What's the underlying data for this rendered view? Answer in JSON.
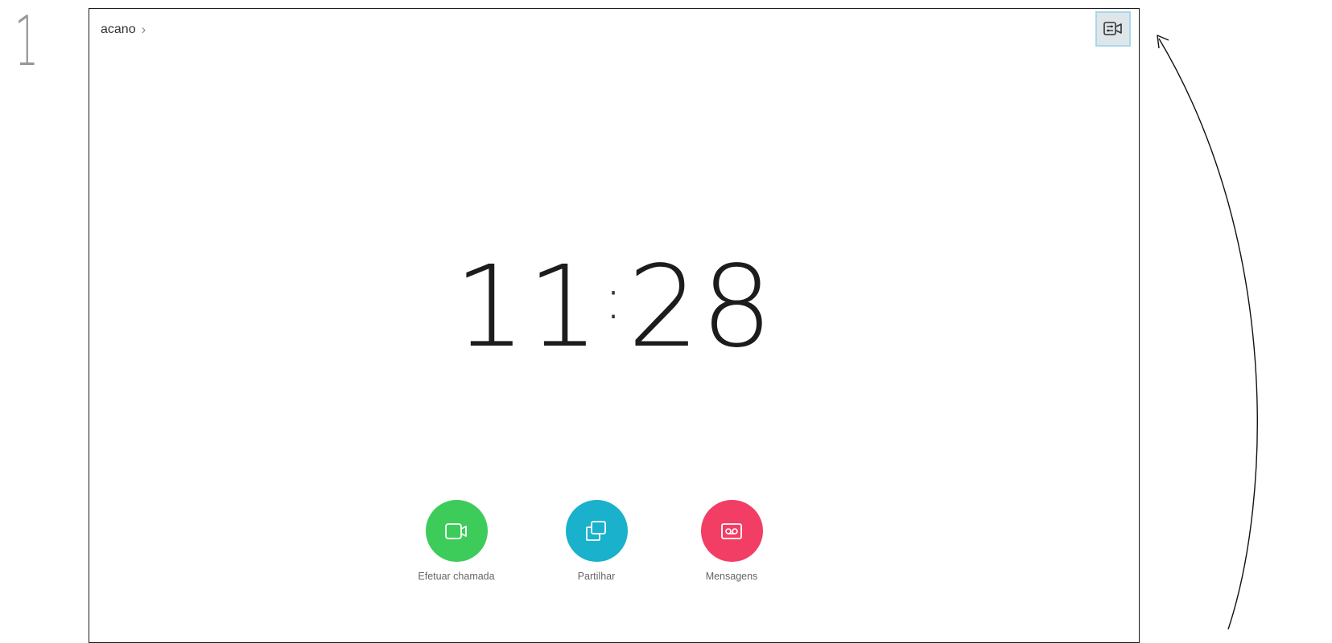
{
  "step": "1",
  "header": {
    "breadcrumb": "acano"
  },
  "clock": {
    "hours": "11",
    "minutes": "28"
  },
  "actions": [
    {
      "label": "Efetuar chamada",
      "color": "#3dcc5a",
      "icon": "video-camera-icon"
    },
    {
      "label": "Partilhar",
      "color": "#1ab1cc",
      "icon": "share-screen-icon"
    },
    {
      "label": "Mensagens",
      "color": "#f23d65",
      "icon": "voicemail-icon"
    }
  ],
  "colors": {
    "highlight": "#a8d8ea"
  }
}
